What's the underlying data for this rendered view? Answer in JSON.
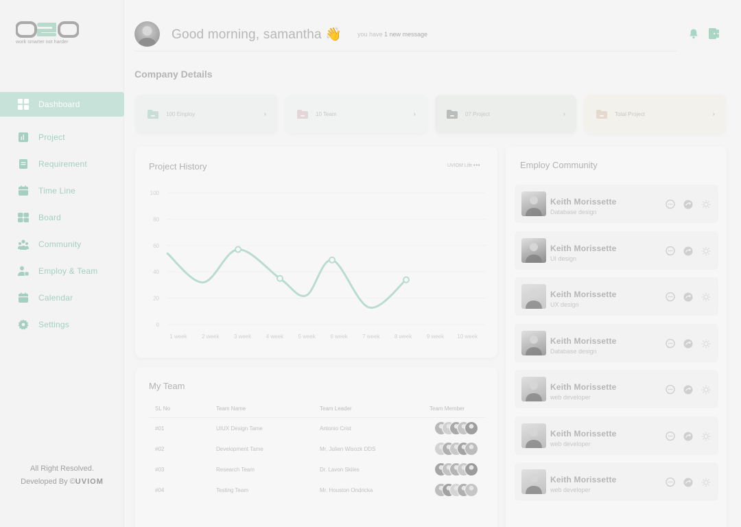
{
  "brand": {
    "logo_text": "d2D",
    "tagline": "work smarter not harder"
  },
  "sidebar": {
    "items": [
      {
        "label": "Dashboard",
        "icon": "grid-icon",
        "active": true
      },
      {
        "label": "Project",
        "icon": "bar-chart-icon"
      },
      {
        "label": "Requirement",
        "icon": "document-icon"
      },
      {
        "label": "Time Line",
        "icon": "calendar-icon"
      },
      {
        "label": "Board",
        "icon": "board-icon"
      },
      {
        "label": "Community",
        "icon": "community-icon"
      },
      {
        "label": "Employ & Team",
        "icon": "team-icon"
      },
      {
        "label": "Calendar",
        "icon": "calendar-icon"
      },
      {
        "label": "Settings",
        "icon": "gear-icon"
      }
    ],
    "footer_line1": "All Right Resolved.",
    "footer_line2_prefix": "Developed By ©",
    "footer_brand": "UVIOM"
  },
  "header": {
    "greeting": "Good morning, samantha 👋",
    "message_prefix": "you have ",
    "message_count": "1 new message"
  },
  "company": {
    "title": "Company Details",
    "stats": [
      {
        "label": "100 Employ",
        "color": "#eef1ef",
        "folder_color": "#c9ded6"
      },
      {
        "label": "10 Team",
        "color": "#f1f2f2",
        "folder_color": "#e3d5d8"
      },
      {
        "label": "07 Project",
        "color": "#eceeec",
        "folder_color": "#b9bdbc"
      },
      {
        "label": "Total Project",
        "color": "#f3f1ec",
        "folder_color": "#e5d9cd"
      }
    ]
  },
  "project_history": {
    "title": "Project History",
    "legend_prefix": "UVIOM Life",
    "legend_dots": "•••"
  },
  "chart_data": {
    "type": "line",
    "title": "Project History",
    "categories": [
      "1 week",
      "2 week",
      "3 week",
      "4 week",
      "5 week",
      "6 week",
      "7 week",
      "8 week",
      "9 week",
      "10 week"
    ],
    "series": [
      {
        "values": [
          54,
          32,
          57,
          35,
          22,
          49,
          13,
          34,
          null,
          null
        ]
      }
    ],
    "yticks": [
      0,
      20,
      40,
      60,
      80,
      100
    ],
    "ylim": [
      0,
      100
    ],
    "color": "#b9dccf"
  },
  "team": {
    "title": "My Team",
    "headers": [
      "SL No",
      "Team Name",
      "Team Leader",
      "Team Member"
    ],
    "rows": [
      {
        "sl": "#01",
        "name": "UIUX Design Tame",
        "leader": "Antonio Crist"
      },
      {
        "sl": "#02",
        "name": "Development Tame",
        "leader": "Mr. Julien Wisozk DDS"
      },
      {
        "sl": "#03",
        "name": "Research Team",
        "leader": "Dr. Lavon Skiles"
      },
      {
        "sl": "#04",
        "name": "Testing Team",
        "leader": "Mr. Houston Ondricka"
      }
    ]
  },
  "community": {
    "title": "Employ Community",
    "members": [
      {
        "name": "Keith Morissette",
        "role": "Database design"
      },
      {
        "name": "Keith Morissette",
        "role": "UI design"
      },
      {
        "name": "Keith Morissette",
        "role": "UX design"
      },
      {
        "name": "Keith Morissette",
        "role": "Database design"
      },
      {
        "name": "Keith Morissette",
        "role": "web developer"
      },
      {
        "name": "Keith Morissette",
        "role": "web developer"
      },
      {
        "name": "Keith Morissette",
        "role": "web developer"
      }
    ]
  }
}
